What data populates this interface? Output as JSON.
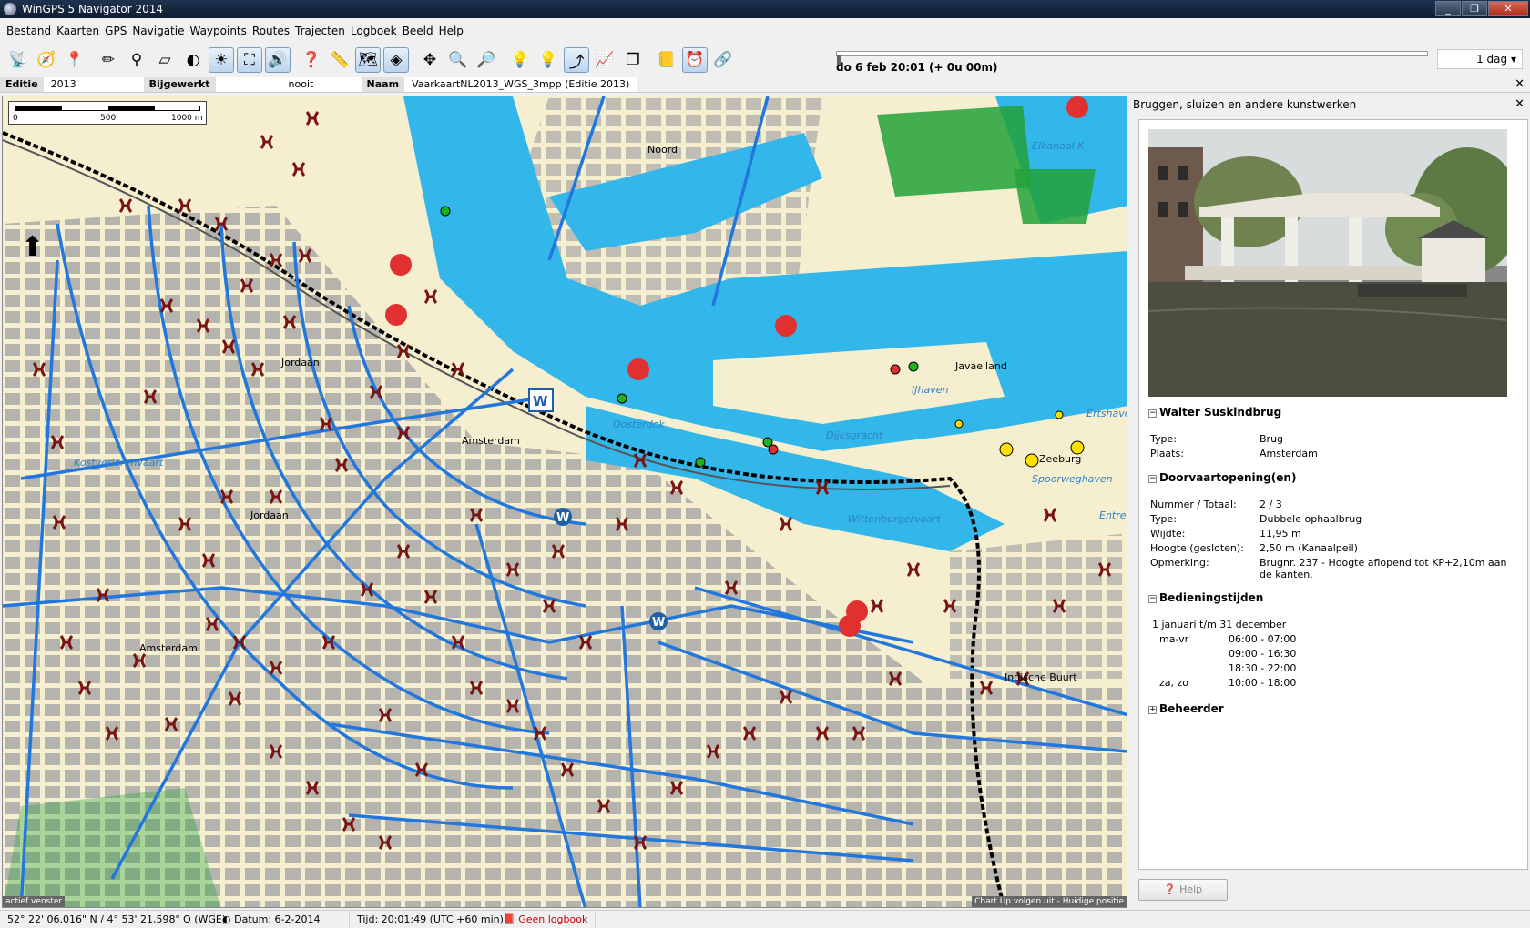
{
  "window": {
    "title": "WinGPS 5 Navigator 2014",
    "buttons": [
      "_",
      "❐",
      "✕"
    ]
  },
  "menu": [
    "Bestand",
    "Kaarten",
    "GPS",
    "Navigatie",
    "Waypoints",
    "Routes",
    "Trajecten",
    "Logboek",
    "Beeld",
    "Help"
  ],
  "toolbar": {
    "icons": [
      "gps-icon",
      "instrument-icon",
      "waypoint-add-icon",
      "measure-icon",
      "route-icon",
      "eraser-icon",
      "moon-icon",
      "weather-icon",
      "bridge-icon",
      "sound-icon",
      "help-icon",
      "ruler-icon",
      "chart-icon",
      "diamond-icon",
      "pan-icon",
      "zoom-in-icon",
      "zoom-out-icon",
      "bulb-off-icon",
      "bulb-on-icon",
      "track-icon",
      "graph-icon",
      "layers-icon",
      "logbook-icon",
      "clock-icon",
      "link-icon"
    ],
    "time_text": "do 6 feb 20:01  (+ 0u 00m)",
    "day_select": "1 dag"
  },
  "infobar": {
    "edition_label": "Editie",
    "edition_value": "2013",
    "updated_label": "Bijgewerkt",
    "updated_value": "nooit",
    "name_label": "Naam",
    "name_value": "VaarkaartNL2013_WGS_3mpp (Editie 2013)"
  },
  "map": {
    "scale_labels": [
      "0",
      "500",
      "1000 m"
    ],
    "labels": [
      {
        "text": "Noord",
        "type": "land"
      },
      {
        "text": "Jordaan",
        "type": "land"
      },
      {
        "text": "Amsterdam",
        "type": "land"
      },
      {
        "text": "Jordaan",
        "type": "land"
      },
      {
        "text": "Amsterdam",
        "type": "land"
      },
      {
        "text": "Javaeiland",
        "type": "land"
      },
      {
        "text": "Zeeburg",
        "type": "land"
      },
      {
        "text": "Indische Buurt",
        "type": "land"
      },
      {
        "text": "IJhaven",
        "type": "water"
      },
      {
        "text": "Oosterdok",
        "type": "water"
      },
      {
        "text": "Dijksgracht",
        "type": "water"
      },
      {
        "text": "Wittenburgervaart",
        "type": "water"
      },
      {
        "text": "Kostverlorenvaart",
        "type": "water"
      },
      {
        "text": "Spoorweghaven",
        "type": "water"
      },
      {
        "text": "Entre",
        "type": "water"
      },
      {
        "text": "Ertshave",
        "type": "water"
      },
      {
        "text": "Elkanaal K",
        "type": "water"
      }
    ],
    "status_left": "actief venster",
    "status_right": "Chart Up volgen uit - Huidige positie"
  },
  "panel": {
    "title": "Bruggen, sluizen en andere kunstwerken",
    "bridge_name": "Walter Suskindbrug",
    "general": [
      {
        "k": "Type:",
        "v": "Brug"
      },
      {
        "k": "Plaats:",
        "v": "Amsterdam"
      }
    ],
    "opening_title": "Doorvaartopening(en)",
    "opening": [
      {
        "k": "Nummer / Totaal:",
        "v": "2 / 3"
      },
      {
        "k": "Type:",
        "v": "Dubbele ophaalbrug"
      },
      {
        "k": "Wijdte:",
        "v": "11,95 m"
      },
      {
        "k": "Hoogte (gesloten):",
        "v": "2,50 m (Kanaalpeil)"
      },
      {
        "k": "Opmerking:",
        "v": "Brugnr. 237 - Hoogte aflopend tot KP+2,10m aan de kanten."
      }
    ],
    "hours_title": "Bedieningstijden",
    "hours_period": "1 januari t/m 31 december",
    "hours": [
      {
        "day": "ma-vr",
        "time": "06:00 - 07:00"
      },
      {
        "day": "",
        "time": "09:00 - 16:30"
      },
      {
        "day": "",
        "time": "18:30 - 22:00"
      },
      {
        "day": "za, zo",
        "time": "10:00 - 18:00"
      }
    ],
    "manager_title": "Beheerder",
    "help_label": "Help"
  },
  "statusbar": {
    "coords": "52° 22' 06,016\" N / 4° 53' 21,598\" O (WGE)",
    "date": "Datum: 6-2-2014",
    "time": "Tijd: 20:01:49 (UTC +60 min)",
    "logbook": "Geen logbook"
  },
  "colors": {
    "land": "#f5efcf",
    "water": "#33b6ea",
    "canal": "#2277dd",
    "bridge": "#7a1414",
    "block": "#a8a8a8",
    "park": "#22a23a"
  }
}
